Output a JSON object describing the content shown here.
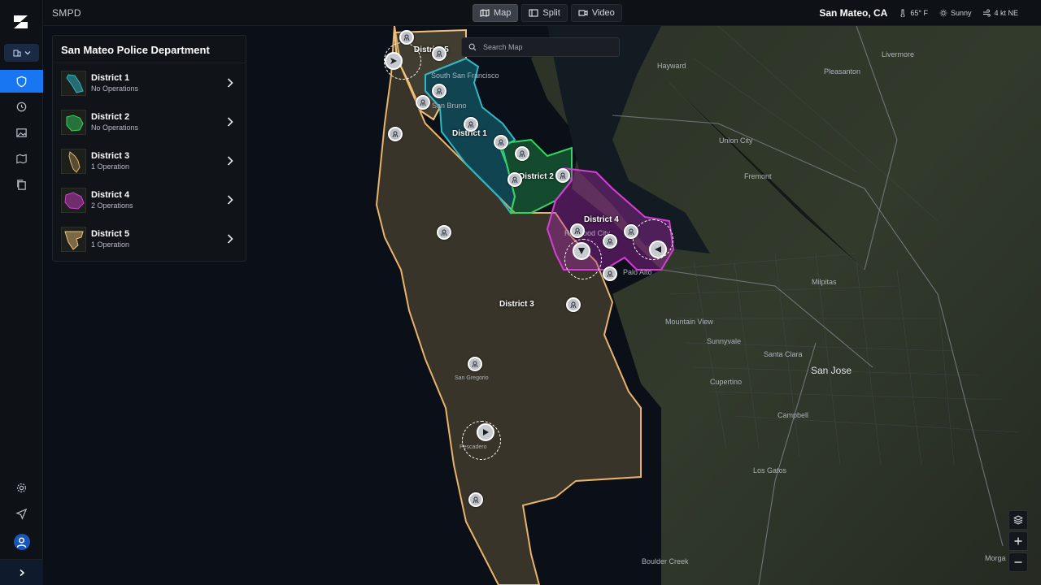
{
  "app": {
    "name": "SMPD"
  },
  "views": [
    {
      "label": "Map",
      "icon": "map-icon",
      "active": true
    },
    {
      "label": "Split",
      "icon": "split-icon",
      "active": false
    },
    {
      "label": "Video",
      "icon": "video-icon",
      "active": false
    }
  ],
  "status": {
    "location": "San Mateo, CA",
    "temperature": "65° F",
    "weather": "Sunny",
    "wind": "4 kt NE"
  },
  "search": {
    "placeholder": "Search Map"
  },
  "panel": {
    "title": "San Mateo Police Department",
    "districts": [
      {
        "name": "District 1",
        "status": "No Operations",
        "color": "#2fb7c4"
      },
      {
        "name": "District 2",
        "status": "No Operations",
        "color": "#36d463"
      },
      {
        "name": "District 3",
        "status": "1 Operation",
        "color": "#e8b36a"
      },
      {
        "name": "District 4",
        "status": "2 Operations",
        "color": "#d43fd4"
      },
      {
        "name": "District 5",
        "status": "1 Operation",
        "color": "#f1c27c"
      }
    ]
  },
  "map_labels": {
    "district_1": "District 1",
    "district_2": "District 2",
    "district_3": "District 3",
    "district_4": "District 4",
    "district_5": "District 5",
    "cities": {
      "hayward": "Hayward",
      "livermore": "Livermore",
      "pleasanton": "Pleasanton",
      "union_city": "Union City",
      "fremont": "Fremont",
      "milpitas": "Milpitas",
      "mountain_view": "Mountain View",
      "sunnyvale": "Sunnyvale",
      "santa_clara": "Santa Clara",
      "san_jose": "San Jose",
      "cupertino": "Cupertino",
      "campbell": "Campbell",
      "los_gatos": "Los Gatos",
      "boulder_creek": "Boulder Creek",
      "south_san_francisco": "South San Francisco",
      "san_bruno": "San Bruno",
      "redwood_city": "Redwood City",
      "palo_alto": "Palo Alto",
      "san_gregorio": "San Gregorio",
      "pescadero": "Pescadero",
      "morgan_hill": "Morga"
    }
  }
}
